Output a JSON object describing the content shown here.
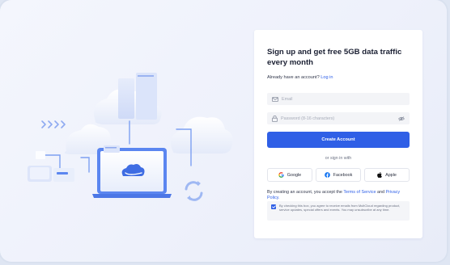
{
  "signup": {
    "title": "Sign up and get free 5GB data traffic every month",
    "have_account": "Already have an account?",
    "login_link": "Log in",
    "email_placeholder": "Email",
    "password_placeholder": "Password (8-16 characters)",
    "create_button": "Create Account",
    "or_sign_in": "or sign in with",
    "social": {
      "google": "Google",
      "facebook": "Facebook",
      "apple": "Apple"
    },
    "terms_prefix": "By creating an account, you accept the",
    "terms_link": "Terms of Service",
    "terms_and": "and",
    "privacy_link": "Privacy Policy.",
    "consent_text": "By checking this box, you agree to receive emails from MultCloud regarding product, service updates, special offers and events. You may unsubscribe at any time.",
    "consent_checked": true
  },
  "colors": {
    "primary": "#2f5fe6",
    "link": "#2f60e8",
    "background": "#eef1fb",
    "card": "#ffffff",
    "illustration_blue": "#5b86f0",
    "illustration_light": "#d6e0fa"
  },
  "icons": {
    "email": "mail-icon",
    "password": "lock-icon",
    "password_toggle": "eye-off-icon",
    "google": "google-logo-icon",
    "facebook": "facebook-logo-icon",
    "apple": "apple-logo-icon",
    "consent": "checkmark-icon"
  }
}
